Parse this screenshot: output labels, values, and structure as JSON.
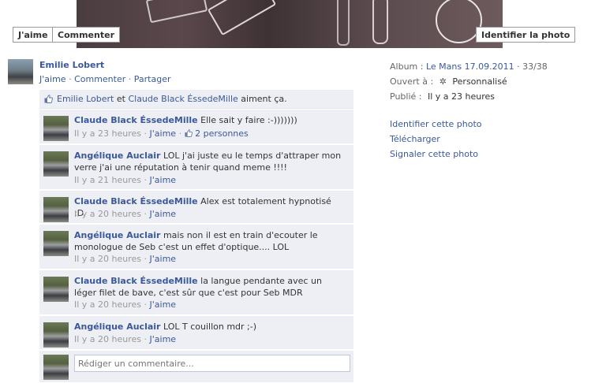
{
  "photo_actions": {
    "like": "J'aime",
    "comment": "Commenter",
    "tag": "Identifier la photo"
  },
  "owner": {
    "name": "Emilie Lobert",
    "actions": [
      "J'aime",
      "Commenter",
      "Partager"
    ],
    "separator": "·"
  },
  "likes": {
    "person1": "Emilie Lobert",
    "joiner": "et",
    "person2": "Claude Black ÉssedeMille",
    "suffix": "aiment ça."
  },
  "comments": [
    {
      "author": "Claude Black ÉssedeMille",
      "text": "Elle sait y faire :-)))))))",
      "time": "Il y a 23 heures",
      "like": "J'aime",
      "likes_count": "2 personnes"
    },
    {
      "author": "Angélique Auclair",
      "text": "LOL j'ai juste eu le temps d'attraper mon verre j'ai une réputation à tenir quand meme !!!!",
      "time": "Il y a 21 heures",
      "like": "J'aime"
    },
    {
      "author": "Claude Black ÉssedeMille",
      "text": "Alex est totalement hypnotisé :D",
      "time": "Il y a 20 heures",
      "like": "J'aime"
    },
    {
      "author": "Angélique Auclair",
      "text": "mais non il est en train d'ecouter le monologue de Seb c'est un effet d'optique.... LOL",
      "time": "Il y a 20 heures",
      "like": "J'aime"
    },
    {
      "author": "Claude Black ÉssedeMille",
      "text": "la langue pendante avec un léger filet de bave, c'est sûr que c'est pour Seb MDR",
      "time": "Il y a 20 heures",
      "like": "J'aime"
    },
    {
      "author": "Angélique Auclair",
      "text": "LOL T couillon mdr ;-)",
      "time": "Il y a 20 heures",
      "like": "J'aime"
    }
  ],
  "reply": {
    "placeholder": "Rédiger un commentaire..."
  },
  "sidebar": {
    "album_label": "Album :",
    "album_name": "Le Mans 17.09.2011",
    "album_position": "· 33/38",
    "open_label": "Ouvert à :",
    "open_value": "Personnalisé",
    "published_label": "Publié :",
    "published_value": "Il y a 23 heures",
    "links": [
      "Identifier cette photo",
      "Télécharger",
      "Signaler cette photo"
    ]
  },
  "icons": {
    "thumb": "thumbs-up-icon",
    "gear": "gear-icon"
  }
}
